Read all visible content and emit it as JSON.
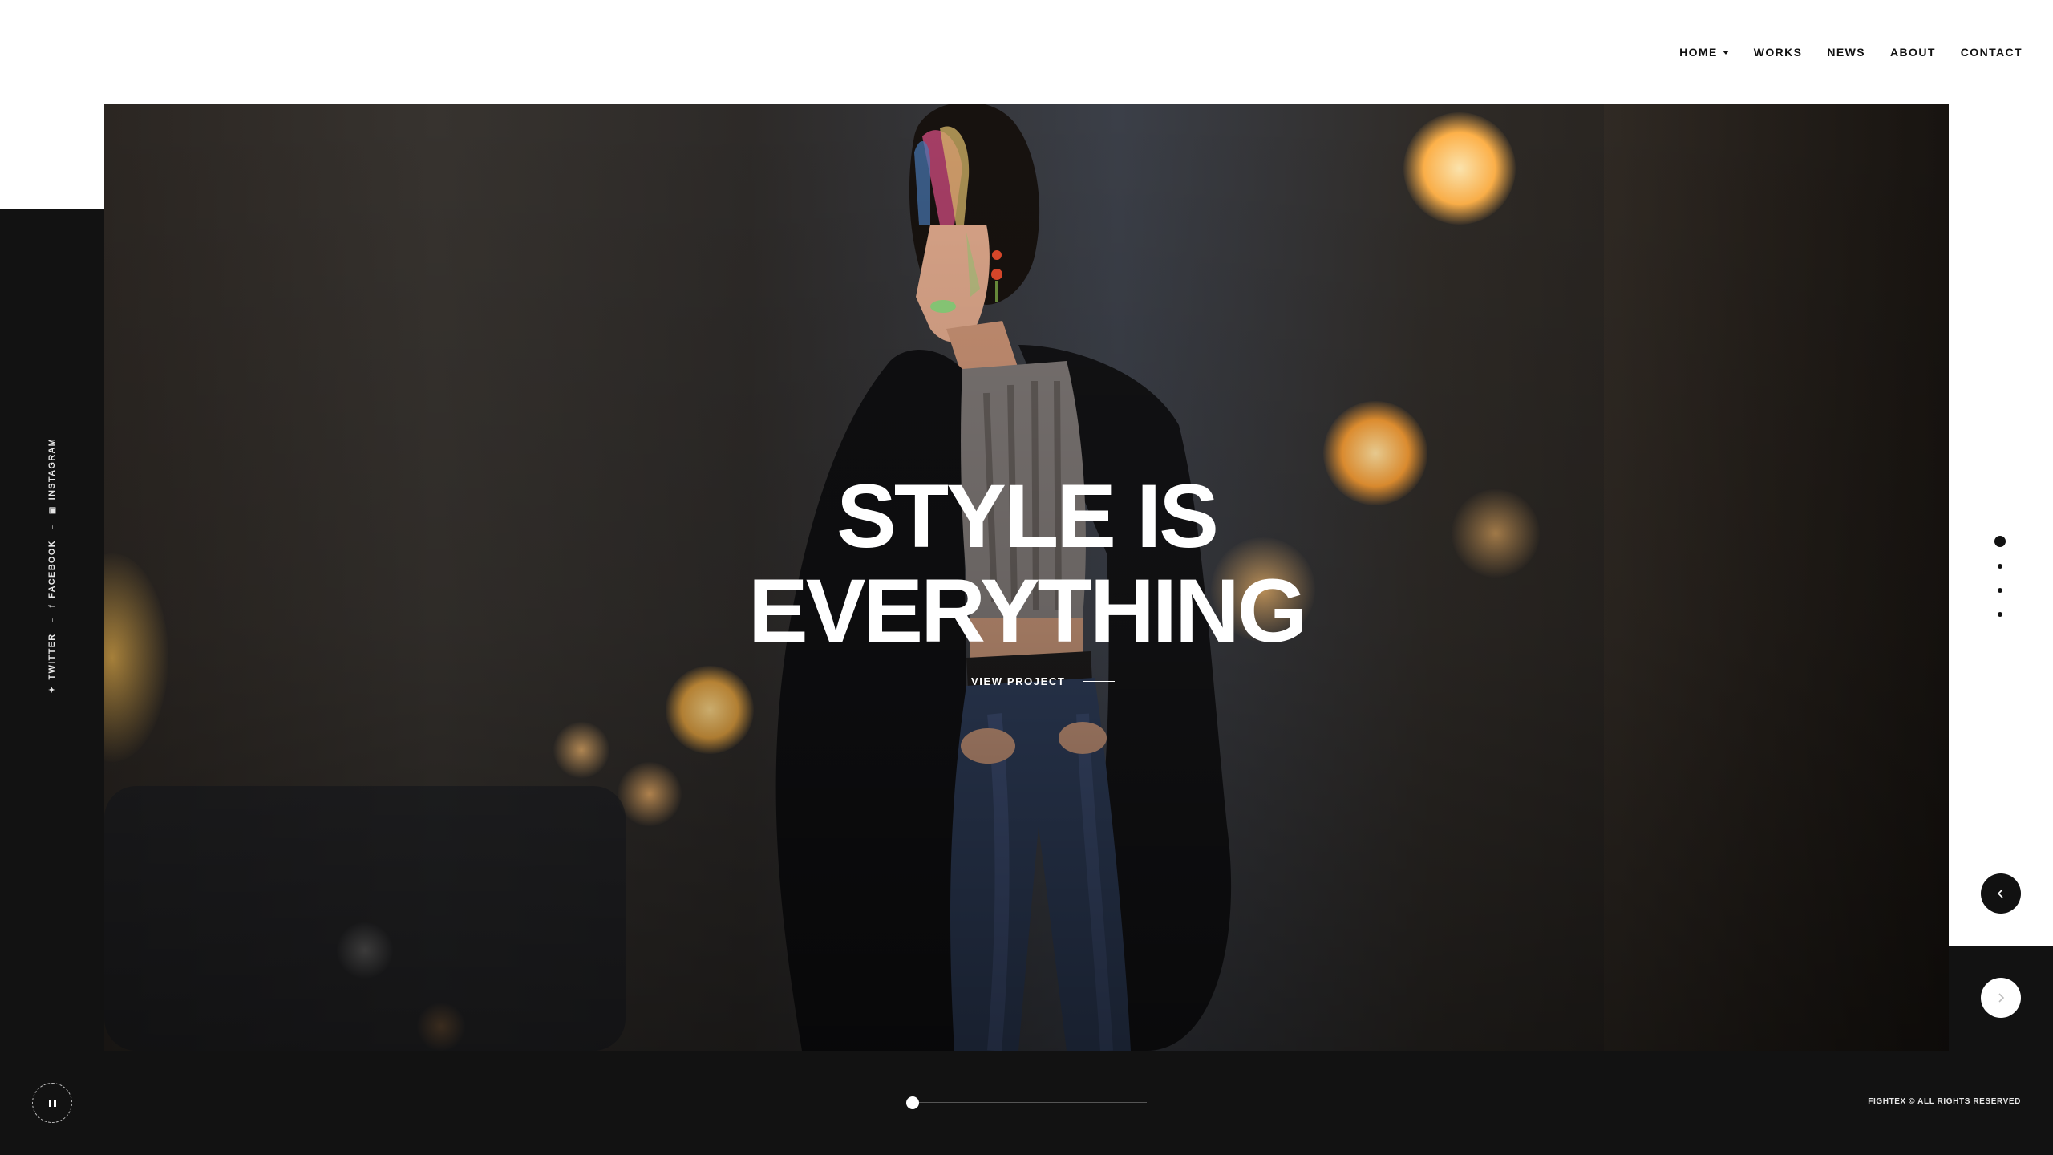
{
  "nav": {
    "items": [
      {
        "label": "HOME"
      },
      {
        "label": "WORKS"
      },
      {
        "label": "NEWS"
      },
      {
        "label": "ABOUT"
      },
      {
        "label": "CONTACT"
      }
    ]
  },
  "hero": {
    "title_line1": "STYLE IS",
    "title_line2": "EVERYTHING",
    "cta_label": "VIEW PROJECT"
  },
  "social": {
    "links": [
      {
        "label": "TWITTER",
        "icon": "twitter-icon"
      },
      {
        "label": "FACEBOOK",
        "icon": "facebook-icon"
      },
      {
        "label": "INSTAGRAM",
        "icon": "instagram-icon"
      }
    ]
  },
  "slider": {
    "slide_count": 4,
    "active_slide": 1,
    "progress": 0.0
  },
  "footer": {
    "copyright": "FIGHTEX © ALL RIGHTS RESERVED"
  },
  "colors": {
    "dark": "#121212",
    "accent": "#ffffff",
    "text": "#111111"
  }
}
